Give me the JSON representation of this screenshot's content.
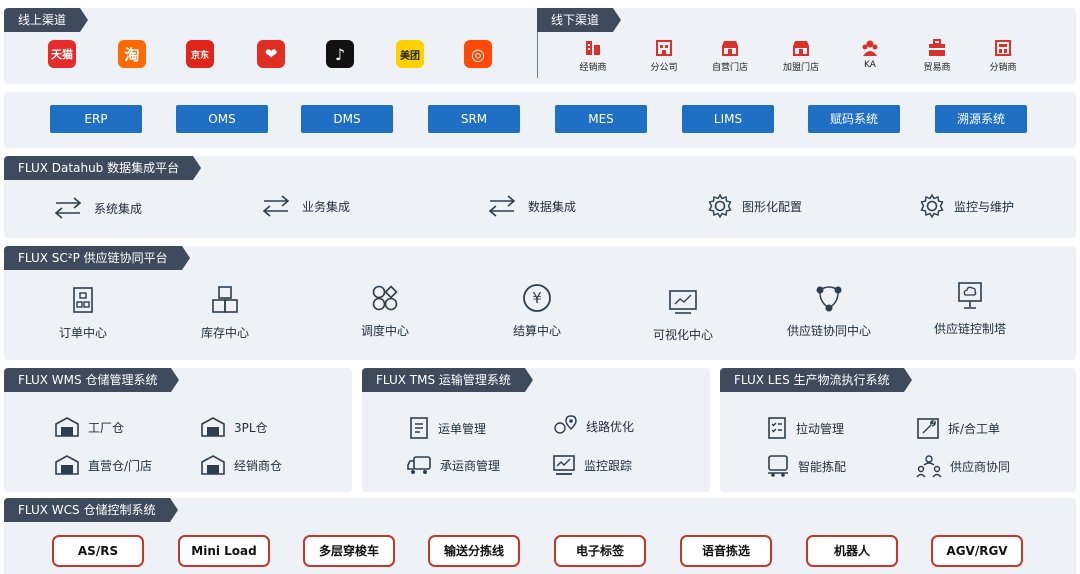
{
  "online": {
    "title": "线上渠道",
    "logos": [
      {
        "name": "tmall-logo",
        "text": "天猫",
        "bg": "#e52b2b"
      },
      {
        "name": "taobao-logo",
        "text": "淘",
        "bg": "#ff6a00"
      },
      {
        "name": "jd-logo",
        "text": "京东",
        "bg": "#e1251b"
      },
      {
        "name": "pinduoduo-logo",
        "text": "❤",
        "bg": "#e02e24"
      },
      {
        "name": "douyin-logo",
        "text": "♪",
        "bg": "#111111"
      },
      {
        "name": "meituan-logo",
        "text": "美团",
        "bg": "#ffd100"
      },
      {
        "name": "kuaishou-logo",
        "text": "◎",
        "bg": "#ff4906"
      }
    ]
  },
  "offline": {
    "title": "线下渠道",
    "items": [
      "经销商",
      "分公司",
      "自营门店",
      "加盟门店",
      "KA",
      "贸易商",
      "分销商"
    ],
    "color": "#d9312b"
  },
  "systems": [
    "ERP",
    "OMS",
    "DMS",
    "SRM",
    "MES",
    "LIMS",
    "赋码系统",
    "溯源系统"
  ],
  "datahub": {
    "title": "FLUX Datahub 数据集成平台",
    "items": [
      "系统集成",
      "业务集成",
      "数据集成",
      "图形化配置",
      "监控与维护"
    ]
  },
  "sc2p": {
    "title": "FLUX SC²P 供应链协同平台",
    "items": [
      "订单中心",
      "库存中心",
      "调度中心",
      "结算中心",
      "可视化中心",
      "供应链协同中心",
      "供应链控制塔"
    ]
  },
  "wms": {
    "title": "FLUX WMS 仓储管理系统",
    "items": [
      "工厂仓",
      "3PL仓",
      "直营仓/门店",
      "经销商仓"
    ]
  },
  "tms": {
    "title": "FLUX TMS 运输管理系统",
    "items": [
      "运单管理",
      "线路优化",
      "承运商管理",
      "监控跟踪"
    ]
  },
  "les": {
    "title": "FLUX LES 生产物流执行系统",
    "items": [
      "拉动管理",
      "拆/合工单",
      "智能拣配",
      "供应商协同"
    ]
  },
  "wcs": {
    "title": "FLUX WCS 仓储控制系统",
    "items": [
      "AS/RS",
      "Mini Load",
      "多层穿梭车",
      "输送分拣线",
      "电子标签",
      "语音拣选",
      "机器人",
      "AGV/RGV"
    ]
  },
  "colors": {
    "accent": "#1f6fc5",
    "tag": "#3d4b5c",
    "panel": "#eef1f5",
    "wcsBorder": "#c0392b"
  }
}
